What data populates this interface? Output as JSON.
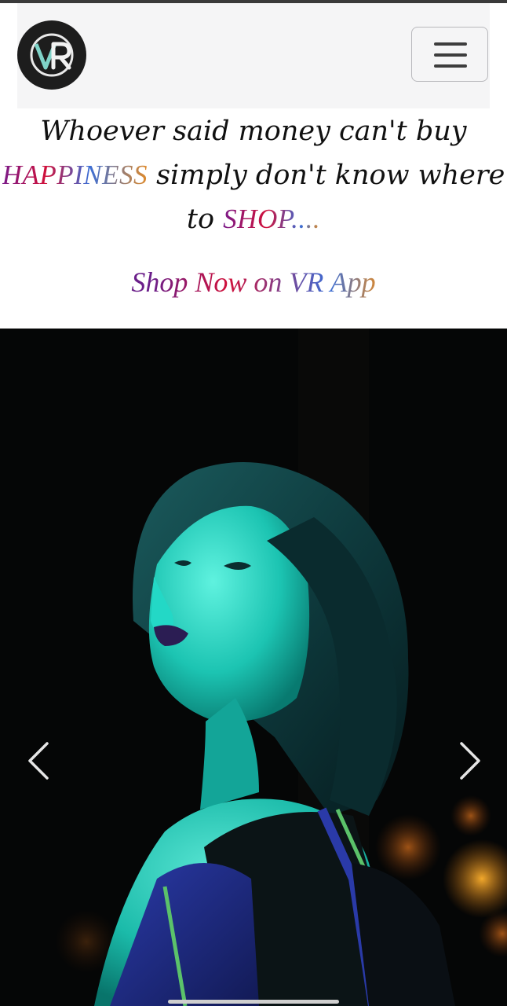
{
  "header": {
    "logo_text": "VR",
    "menu_label": "Toggle navigation"
  },
  "tagline": {
    "part1": "Whoever said money can't buy",
    "highlight1": "HAPPINESS",
    "part2": " simply don't know where",
    "part3": "to ",
    "highlight2": "SHOP....",
    "accent_colors": [
      "#7a1a8a",
      "#d0103a",
      "#3b6ed6",
      "#e08a2a"
    ]
  },
  "cta": {
    "label": "Shop Now on VR App"
  },
  "carousel": {
    "image": "neon-portrait-woman",
    "prev_icon": "chevron-left-icon",
    "next_icon": "chevron-right-icon"
  }
}
